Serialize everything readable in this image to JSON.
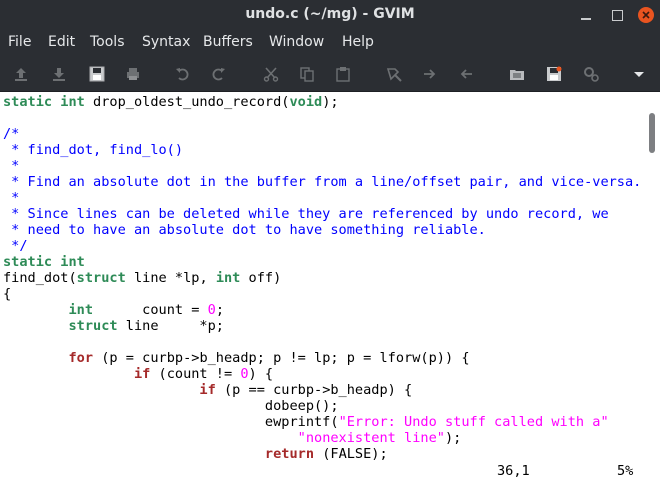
{
  "window": {
    "title": "undo.c (~/mg) - GVIM"
  },
  "menu": [
    "File",
    "Edit",
    "Tools",
    "Syntax",
    "Buffers",
    "Window",
    "Help"
  ],
  "toolbar": {
    "icons": [
      "open-icon",
      "save-icon",
      "save-floppy-icon",
      "print-icon",
      "undo-icon",
      "redo-icon",
      "cut-icon",
      "copy-icon",
      "paste-icon",
      "find-replace-icon",
      "find-next-icon",
      "find-previous-icon",
      "load-session-icon",
      "save-session-icon",
      "run-script-icon",
      "overflow-menu-icon"
    ]
  },
  "code_lines": [
    [
      {
        "t": "static int",
        "c": "kw"
      },
      {
        "t": " drop_oldest_undo_record("
      },
      {
        "t": "void",
        "c": "kw"
      },
      {
        "t": ");"
      }
    ],
    [],
    [
      {
        "t": "/*",
        "c": "cmt"
      }
    ],
    [
      {
        "t": " * find_dot, find_lo()",
        "c": "cmt"
      }
    ],
    [
      {
        "t": " *",
        "c": "cmt"
      }
    ],
    [
      {
        "t": " * Find an absolute dot in the buffer from a line/offset pair, and vice-versa.",
        "c": "cmt"
      }
    ],
    [
      {
        "t": " *",
        "c": "cmt"
      }
    ],
    [
      {
        "t": " * Since lines can be deleted while they are referenced by undo record, we",
        "c": "cmt"
      }
    ],
    [
      {
        "t": " * need to have an absolute dot to have something reliable.",
        "c": "cmt"
      }
    ],
    [
      {
        "t": " */",
        "c": "cmt"
      }
    ],
    [
      {
        "t": "static int",
        "c": "kw"
      }
    ],
    [
      {
        "t": "find_dot("
      },
      {
        "t": "struct",
        "c": "kw"
      },
      {
        "t": " line *lp, "
      },
      {
        "t": "int",
        "c": "kw"
      },
      {
        "t": " off)"
      }
    ],
    [
      {
        "t": "{"
      }
    ],
    [
      {
        "t": "        "
      },
      {
        "t": "int",
        "c": "kw"
      },
      {
        "t": "      count = "
      },
      {
        "t": "0",
        "c": "num"
      },
      {
        "t": ";"
      }
    ],
    [
      {
        "t": "        "
      },
      {
        "t": "struct",
        "c": "kw"
      },
      {
        "t": " line     *p;"
      }
    ],
    [],
    [
      {
        "t": "        "
      },
      {
        "t": "for",
        "c": "ctl"
      },
      {
        "t": " (p = curbp->b_headp; p != lp; p = lforw(p)) {"
      }
    ],
    [
      {
        "t": "                "
      },
      {
        "t": "if",
        "c": "ctl"
      },
      {
        "t": " (count != "
      },
      {
        "t": "0",
        "c": "num"
      },
      {
        "t": ") {"
      }
    ],
    [
      {
        "t": "                        "
      },
      {
        "t": "if",
        "c": "ctl"
      },
      {
        "t": " (p == curbp->b_headp) {"
      }
    ],
    [
      {
        "t": "                                dobeep();"
      }
    ],
    [
      {
        "t": "                                ewprintf("
      },
      {
        "t": "\"Error: Undo stuff called with a\"",
        "c": "str"
      }
    ],
    [
      {
        "t": "                                    "
      },
      {
        "t": "\"nonexistent line\"",
        "c": "str"
      },
      {
        "t": ");"
      }
    ],
    [
      {
        "t": "                                "
      },
      {
        "t": "return",
        "c": "ctl"
      },
      {
        "t": " (FALSE);"
      }
    ]
  ],
  "status": {
    "position": "36,1",
    "percent": "5%"
  }
}
